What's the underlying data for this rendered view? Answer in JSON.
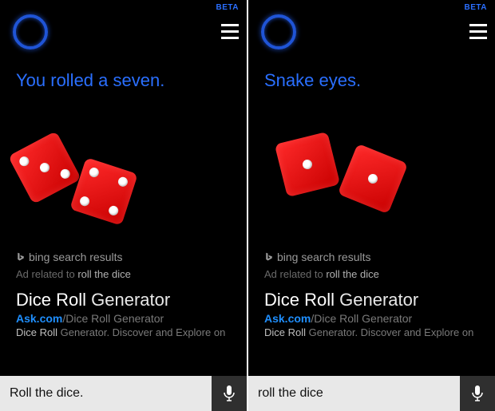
{
  "panes": [
    {
      "beta": "BETA",
      "response": "You rolled a seven.",
      "dice": [
        3,
        4
      ],
      "bing_label": "bing search results",
      "ad_prefix": "Ad related to ",
      "ad_query": "roll the dice",
      "result": {
        "title_bold": "Dice Roll",
        "title_rest": " Generator",
        "url_domain": "Ask.com",
        "url_path": "/Dice Roll Generator",
        "snippet_hl": "Dice Roll",
        "snippet_rest": " Generator. Discover and Explore on"
      },
      "input_value": "Roll the dice."
    },
    {
      "beta": "BETA",
      "response": "Snake eyes.",
      "dice": [
        1,
        1
      ],
      "bing_label": "bing search results",
      "ad_prefix": "Ad related to ",
      "ad_query": "roll the dice",
      "result": {
        "title_bold": "Dice Roll",
        "title_rest": " Generator",
        "url_domain": "Ask.com",
        "url_path": "/Dice Roll Generator",
        "snippet_hl": "Dice Roll",
        "snippet_rest": " Generator. Discover and Explore on"
      },
      "input_value": "roll the dice"
    }
  ]
}
